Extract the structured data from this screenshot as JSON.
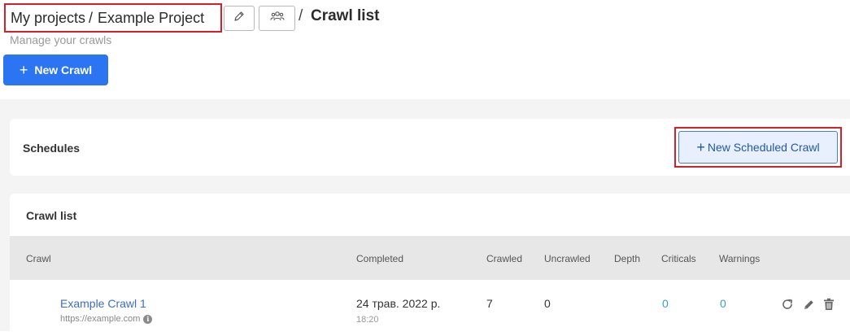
{
  "header": {
    "breadcrumb": {
      "root": "My projects",
      "separator": "/",
      "project": "Example Project"
    },
    "edit_icon": "pencil-icon",
    "team_icon": "users-icon",
    "title_separator": "/",
    "title": "Crawl list",
    "subtitle": "Manage your crawls",
    "new_crawl_label": "New Crawl",
    "new_crawl_icon": "+"
  },
  "schedules": {
    "title": "Schedules",
    "new_scheduled_icon": "+",
    "new_scheduled_label": "New Scheduled Crawl"
  },
  "crawl_list": {
    "title": "Crawl list",
    "columns": [
      "Crawl",
      "Completed",
      "Crawled",
      "Uncrawled",
      "Depth",
      "Criticals",
      "Warnings"
    ],
    "rows": [
      {
        "name": "Example Crawl 1",
        "url": "https://example.com",
        "completed_date": "24 трав. 2022 р.",
        "completed_time": "18:20",
        "crawled": "7",
        "uncrawled": "0",
        "depth": "",
        "criticals": "0",
        "warnings": "0",
        "actions": [
          "refresh-icon",
          "pencil-icon",
          "trash-icon"
        ]
      }
    ]
  },
  "colors": {
    "primary": "#2b74f2",
    "highlight_outline": "#d4202a",
    "link": "#3b6ec2",
    "count_link": "#3a9fc4",
    "page_bg": "#f4f4f4",
    "table_header_bg": "#e7e7e7"
  }
}
